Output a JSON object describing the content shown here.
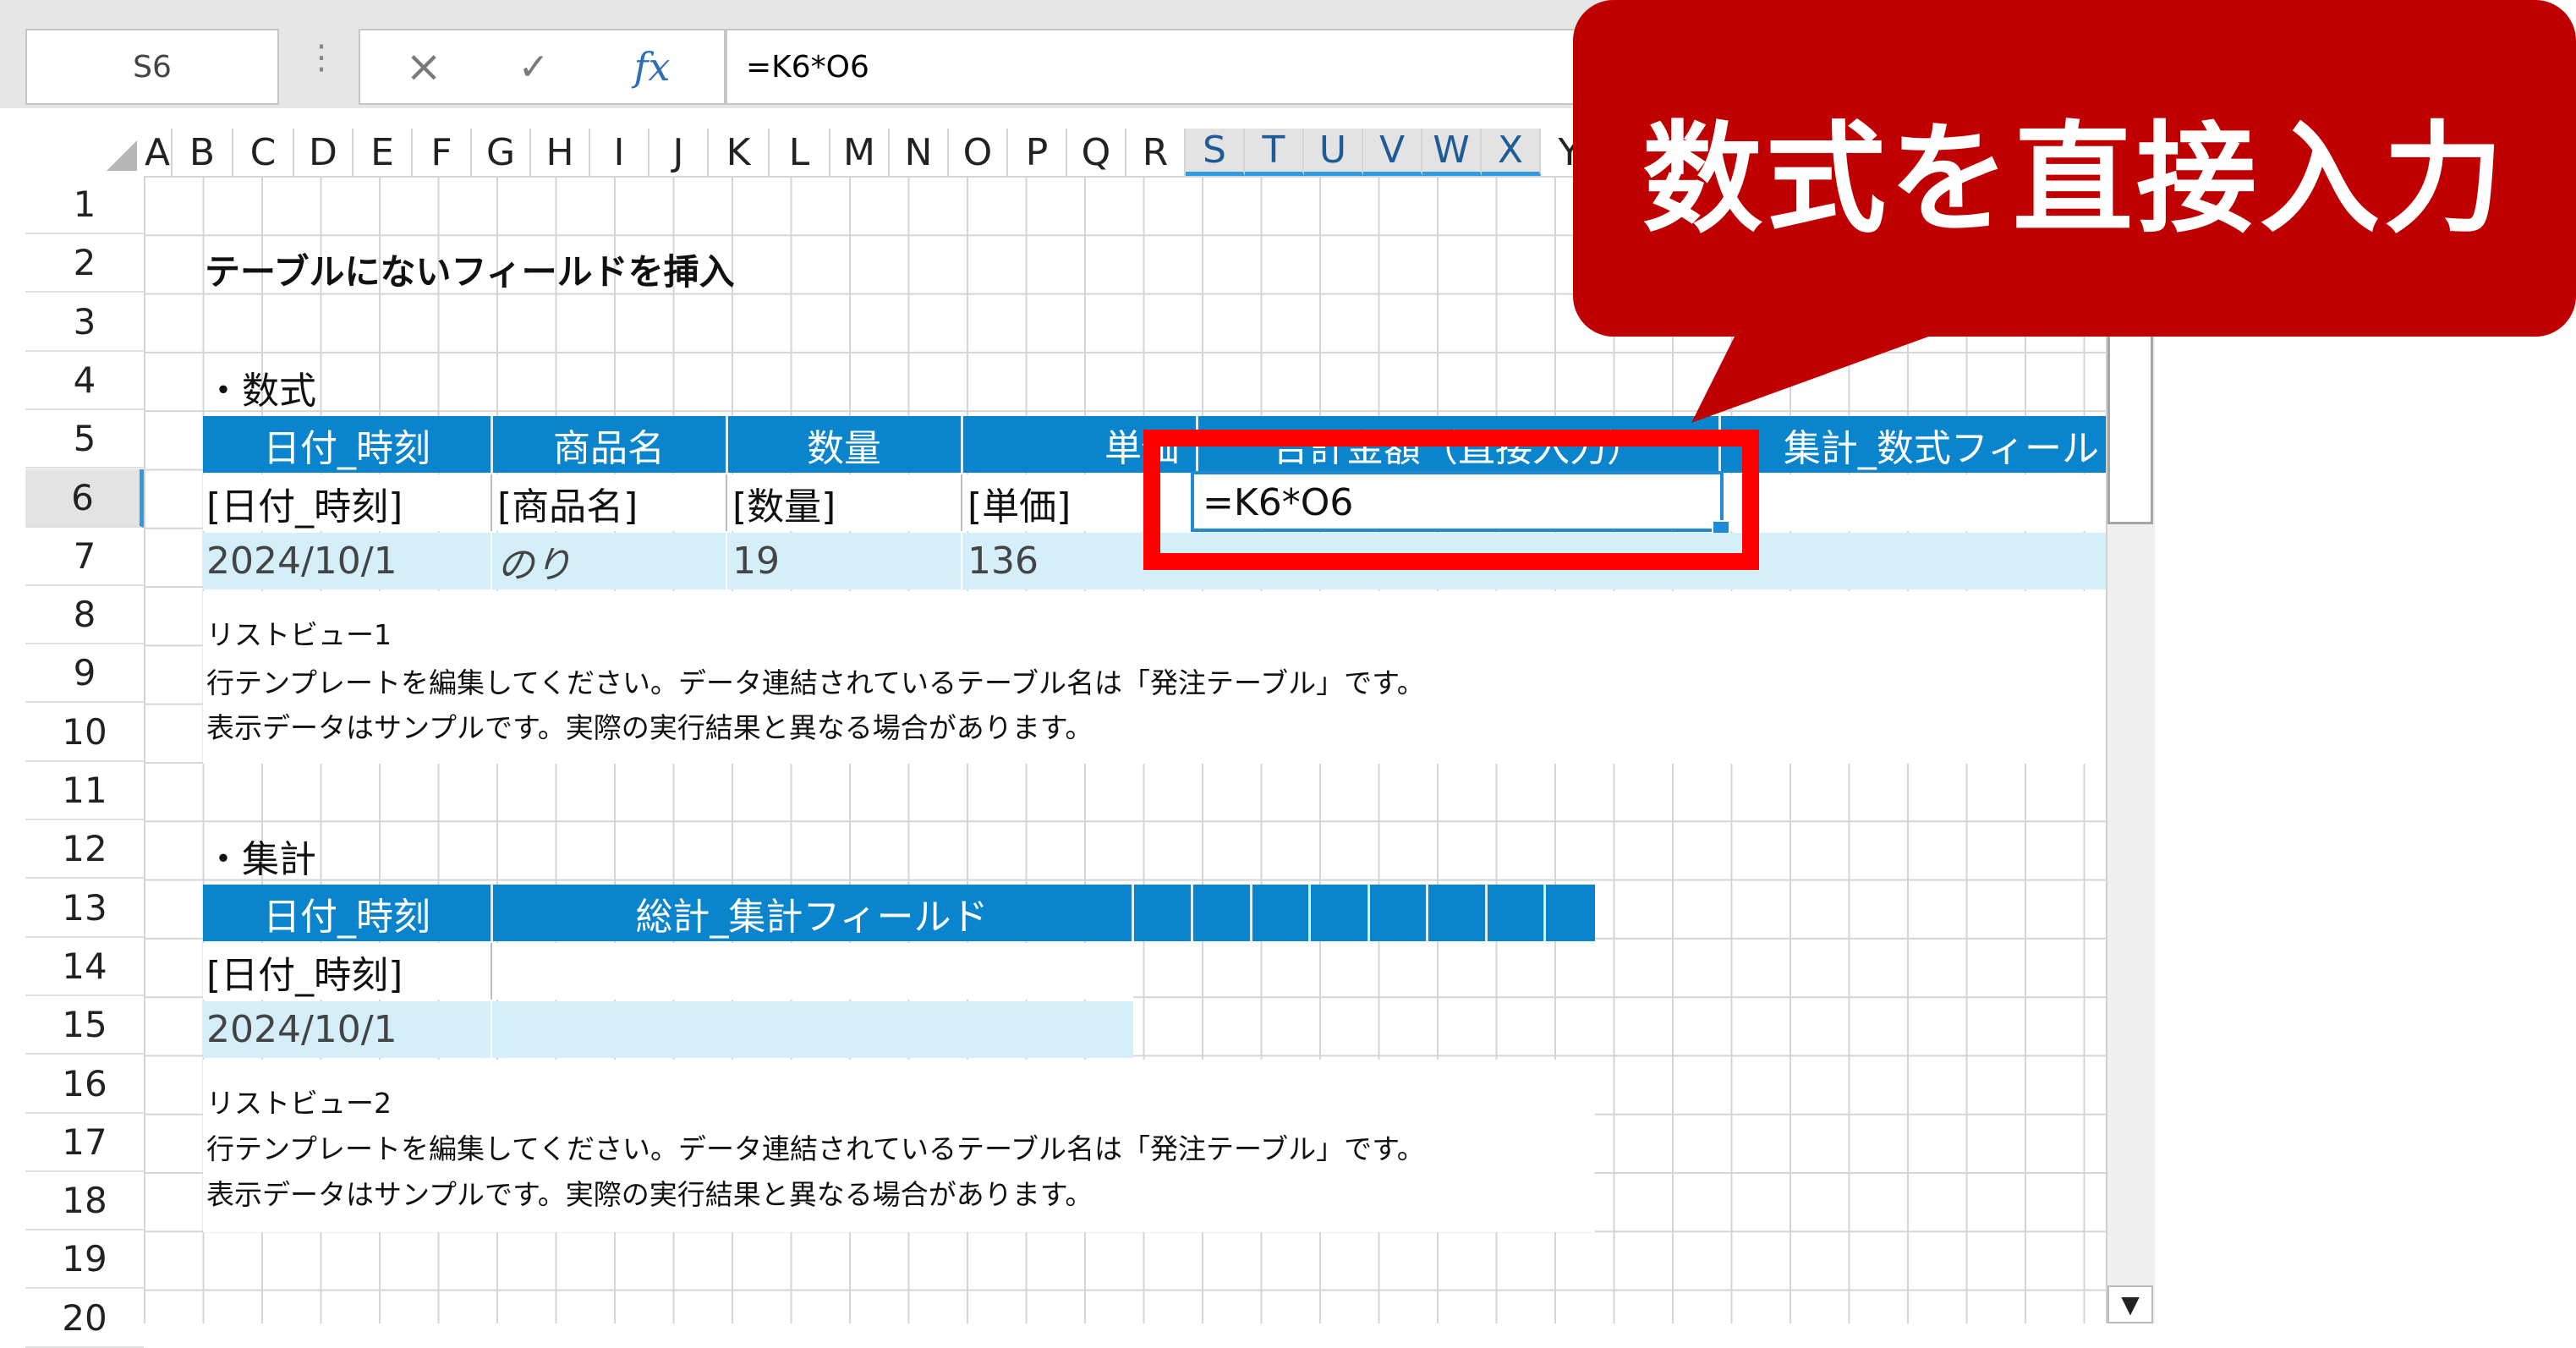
{
  "formula_bar": {
    "name_box": "S6",
    "cancel_icon": "×",
    "enter_icon": "✓",
    "fx_label": "fx",
    "formula": "=K6*O6"
  },
  "columns": [
    "A",
    "B",
    "C",
    "D",
    "E",
    "F",
    "G",
    "H",
    "I",
    "J",
    "K",
    "L",
    "M",
    "N",
    "O",
    "P",
    "Q",
    "R",
    "S",
    "T",
    "U",
    "V",
    "W",
    "X",
    "Y"
  ],
  "selected_columns": [
    "S",
    "T",
    "U",
    "V",
    "W",
    "X"
  ],
  "rows": [
    "1",
    "2",
    "3",
    "4",
    "5",
    "6",
    "7",
    "8",
    "9",
    "10",
    "11",
    "12",
    "13",
    "14",
    "15",
    "16",
    "17",
    "18",
    "19",
    "20"
  ],
  "selected_row": "6",
  "sheet": {
    "title": "テーブルにないフィールドを挿入",
    "section1": {
      "label": "・数式",
      "headers": [
        "日付_時刻",
        "商品名",
        "数量",
        "単価",
        "合計金額（直接入力）",
        "集計_数式フィール"
      ],
      "template_row": [
        "[日付_時刻]",
        "[商品名]",
        "[数量]",
        "[単価]",
        "=K6*O6"
      ],
      "sample_row": [
        "2024/10/1",
        "のり",
        "19",
        "136"
      ],
      "notes": [
        "リストビュー1",
        "行テンプレートを編集してください。データ連結されているテーブル名は「発注テーブル」です。",
        "表示データはサンプルです。実際の実行結果と異なる場合があります。"
      ]
    },
    "section2": {
      "label": "・集計",
      "headers": [
        "日付_時刻",
        "総計_集計フィールド"
      ],
      "template_row": [
        "[日付_時刻]"
      ],
      "sample_row": [
        "2024/10/1"
      ],
      "notes": [
        "リストビュー2",
        "行テンプレートを編集してください。データ連結されているテーブル名は「発注テーブル」です。",
        "表示データはサンプルです。実際の実行結果と異なる場合があります。"
      ]
    }
  },
  "callout": {
    "text": "数式を直接入力",
    "color": "#c00000"
  },
  "colors": {
    "header_blue": "#0a84cc",
    "sample_row_blue": "#d4eefa",
    "selection_blue": "#1f8ad6",
    "highlight_red": "#ff0000"
  }
}
